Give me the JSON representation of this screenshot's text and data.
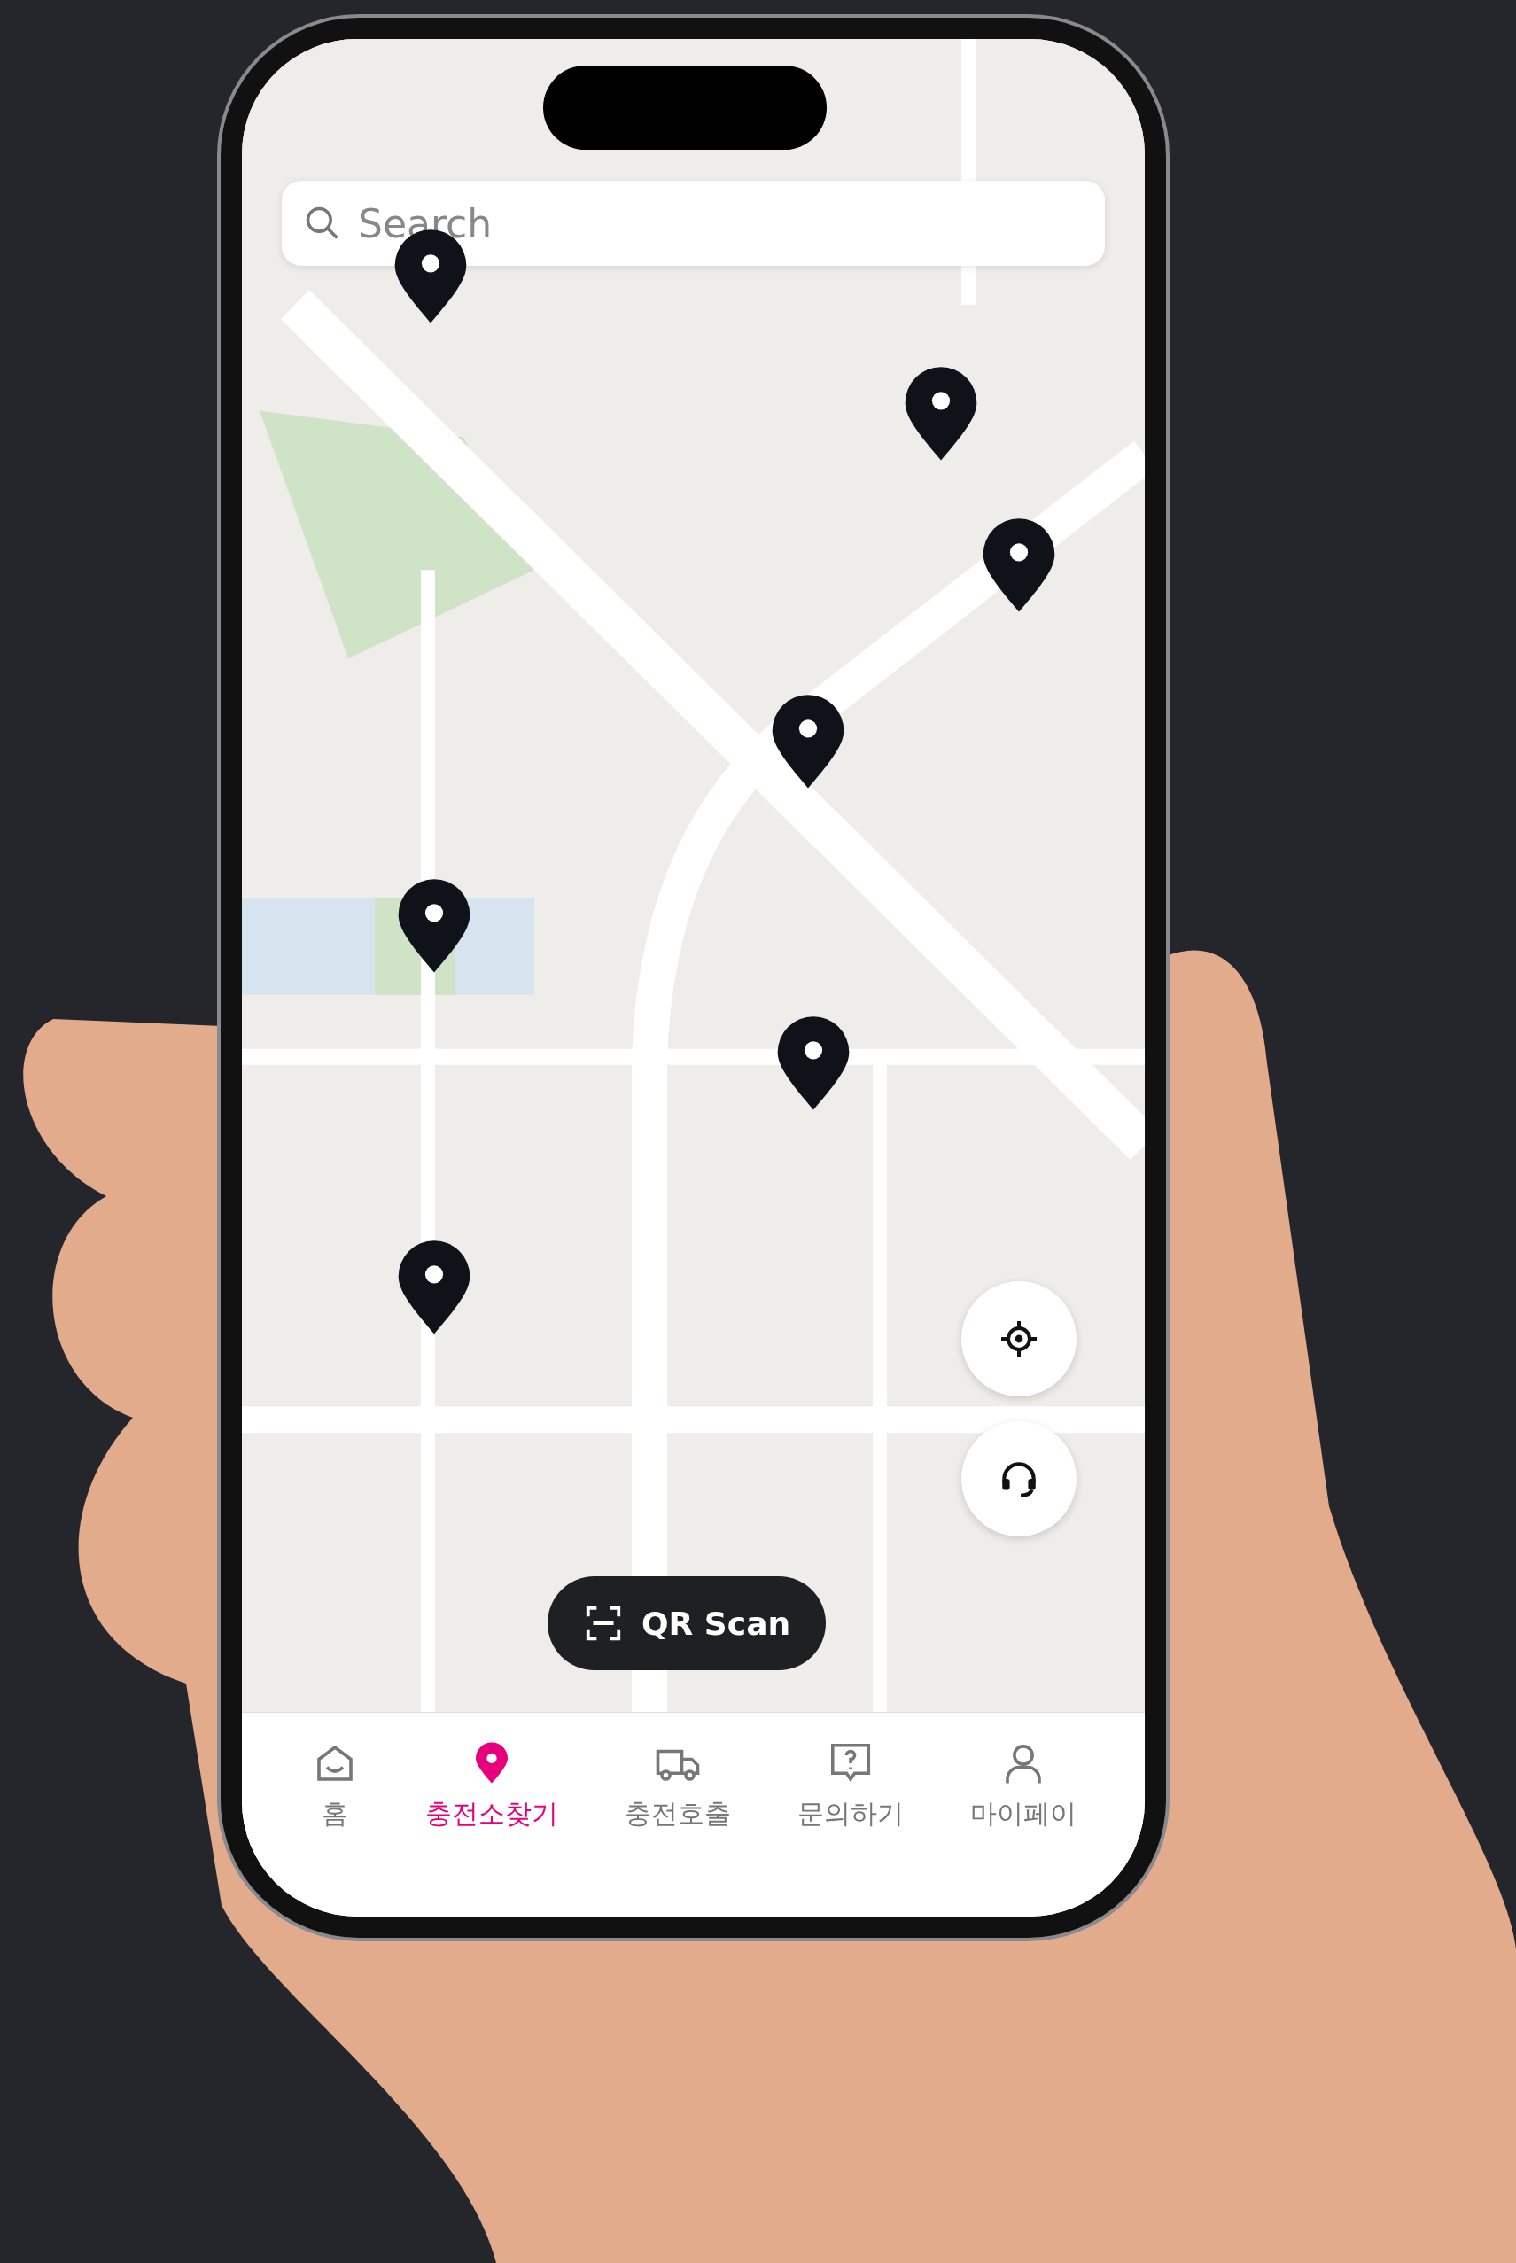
{
  "search": {
    "placeholder": "Search"
  },
  "qr_button": {
    "label": "QR Scan"
  },
  "nav": [
    {
      "label": "홈",
      "selected": false,
      "kind": "home"
    },
    {
      "label": "충전소찾기",
      "selected": true,
      "kind": "pin"
    },
    {
      "label": "충전호출",
      "selected": false,
      "kind": "truck"
    },
    {
      "label": "문의하기",
      "selected": false,
      "kind": "question"
    },
    {
      "label": "마이페이",
      "selected": false,
      "kind": "person"
    }
  ]
}
